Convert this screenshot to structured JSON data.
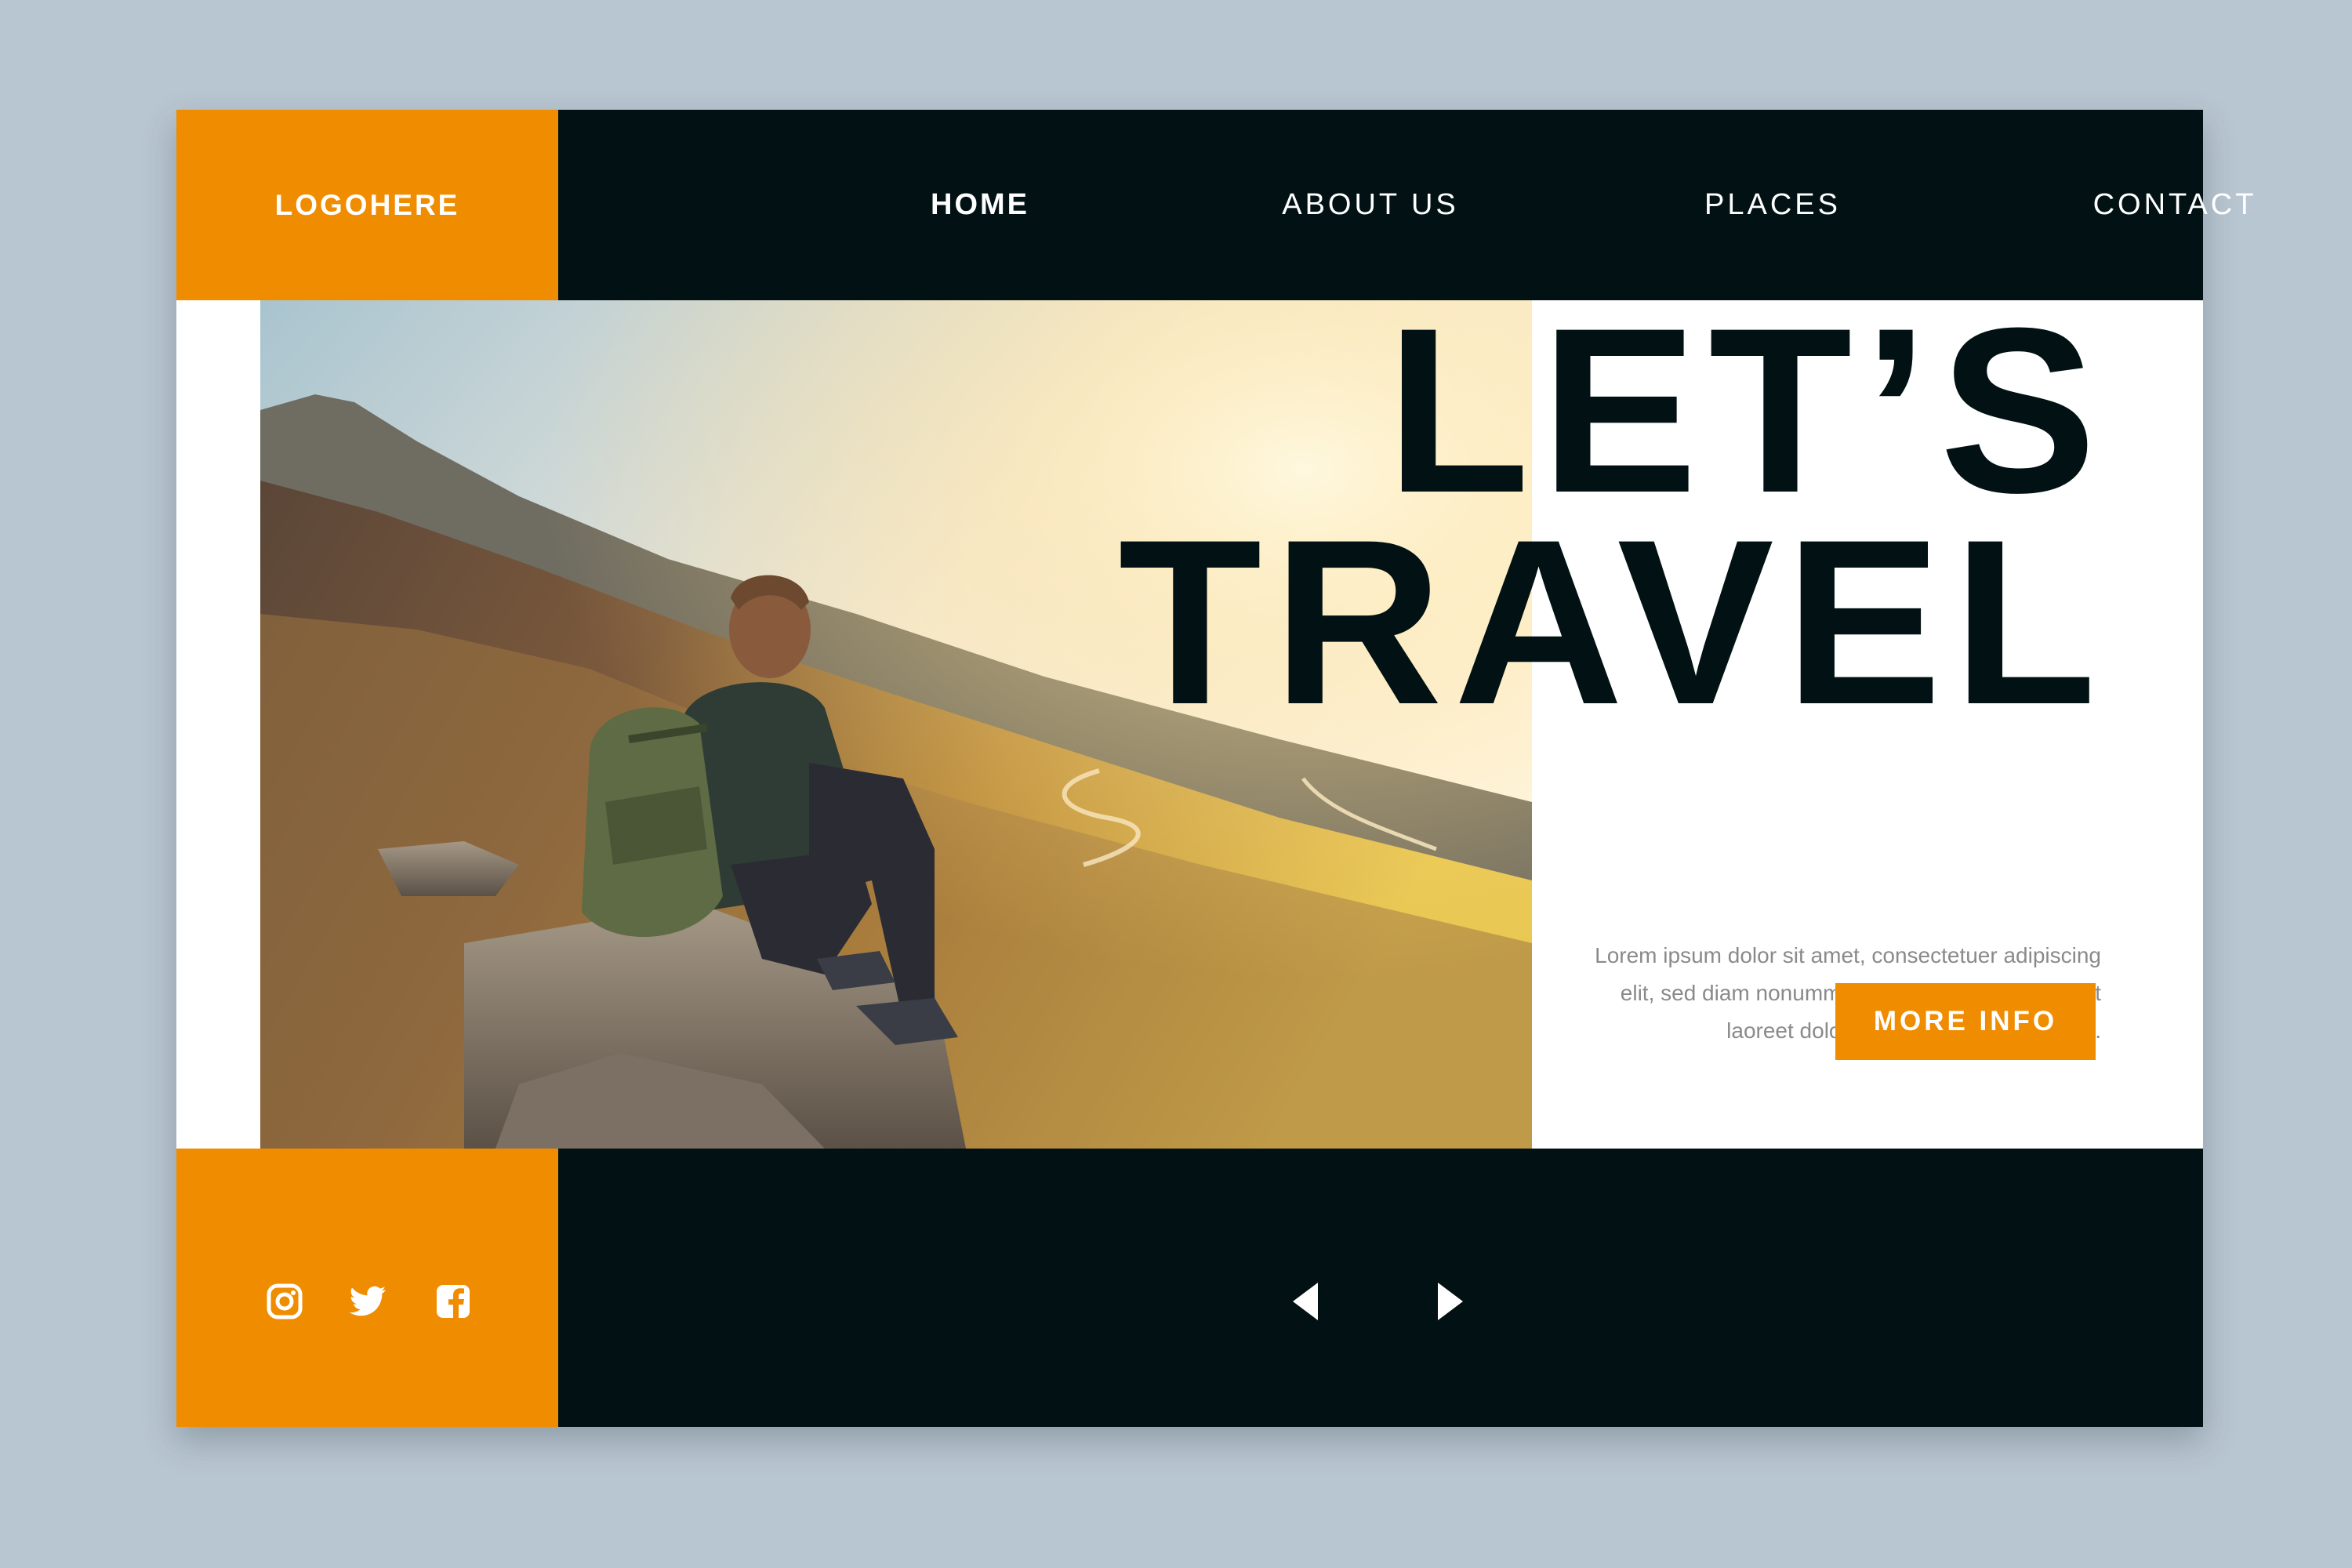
{
  "header": {
    "logo": "LOGOHERE",
    "nav": [
      {
        "label": "HOME",
        "active": true
      },
      {
        "label": "ABOUT US",
        "active": false
      },
      {
        "label": "PLACES",
        "active": false
      },
      {
        "label": "CONTACT",
        "active": false
      }
    ]
  },
  "hero": {
    "headline_line1": "LET’S",
    "headline_line2": "TRAVEL",
    "body_line1": "Lorem ipsum dolor sit amet, consectetuer adipiscing",
    "body_line2": "elit, sed diam nonummy nibh euismod tincidunt ut",
    "body_line3": "laoreet dolore magna aliquam erat vol.",
    "cta_label": "MORE INFO"
  },
  "footer": {
    "social_icons": [
      "instagram-icon",
      "twitter-icon",
      "facebook-icon"
    ],
    "carousel_controls": [
      "previous-arrow-icon",
      "next-arrow-icon"
    ]
  },
  "colors": {
    "accent": "#f08c00",
    "dark": "#021214",
    "background": "#b8c6d1",
    "body_text": "#8a8a8a"
  }
}
